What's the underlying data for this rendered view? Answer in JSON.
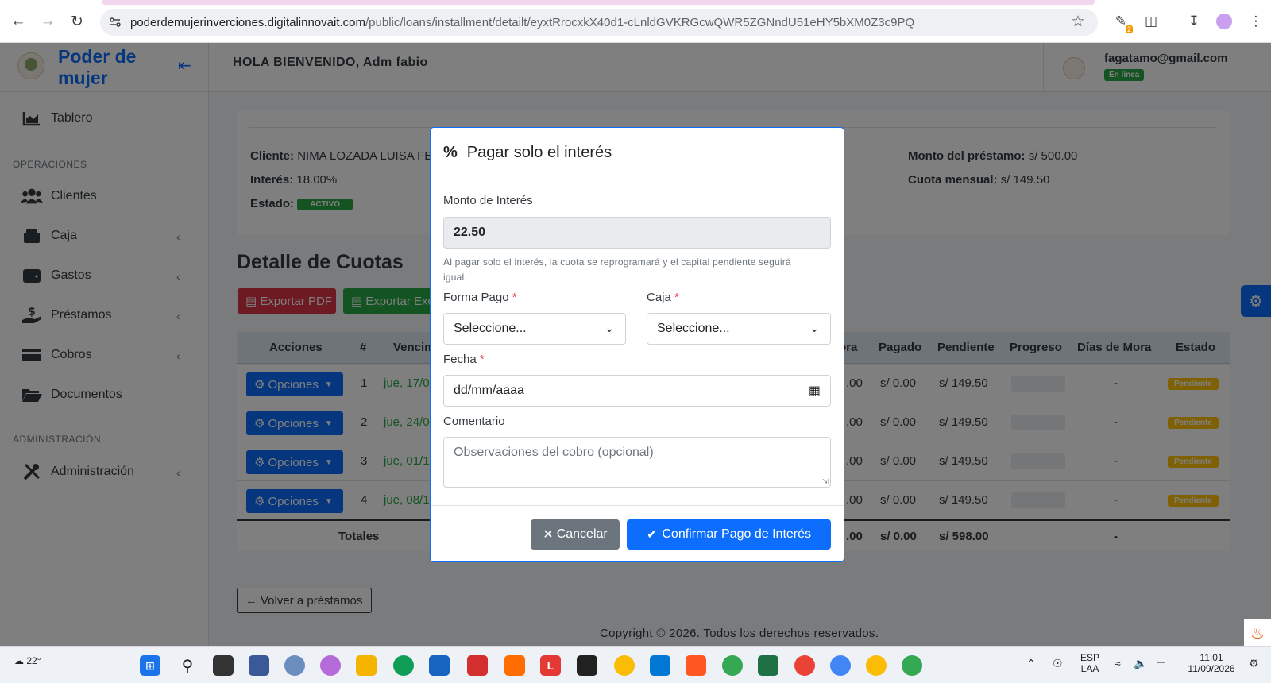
{
  "browser": {
    "url_host": "poderdemujerinverciones.digitalinnovait.com",
    "url_path": "/public/loans/installment/detailt/eyxtRrocxkX40d1-cLnldGVKRGcwQWR5ZGNndU51eHY5bXM0Z3c9PQ",
    "ext_badge": "2"
  },
  "sidebar": {
    "brand": "Poder de mujer",
    "items": [
      {
        "label": "Tablero",
        "icon": "chart-area-icon"
      },
      {
        "label": "Clientes",
        "icon": "users-icon"
      },
      {
        "label": "Caja",
        "icon": "cash-box-icon"
      },
      {
        "label": "Gastos",
        "icon": "wallet-icon"
      },
      {
        "label": "Préstamos",
        "icon": "hand-dollar-icon"
      },
      {
        "label": "Cobros",
        "icon": "credit-card-icon"
      },
      {
        "label": "Documentos",
        "icon": "folder-icon"
      },
      {
        "label": "Administración",
        "icon": "tools-icon"
      }
    ],
    "sections": {
      "operaciones": "OPERACIONES",
      "administracion": "ADMINISTRACIÓN"
    }
  },
  "topbar": {
    "greeting": "HOLA BIENVENIDO, Adm fabio",
    "email": "fagatamo@gmail.com",
    "status": "En línea"
  },
  "loan": {
    "cliente_label": "Cliente:",
    "cliente": "NIMA LOZADA LUISA FE",
    "interes_label": "Interés:",
    "interes": "18.00%",
    "estado_label": "Estado:",
    "estado": "ACTIVO",
    "monto_label": "Monto del préstamo:",
    "monto": "s/ 500.00",
    "cuota_label": "Cuota mensual:",
    "cuota": "s/ 149.50"
  },
  "detail": {
    "title": "Detalle de Cuotas",
    "export_pdf": "Exportar PDF",
    "export_excel": "Exportar Exc",
    "columns": [
      "Acciones",
      "#",
      "Vencim",
      "ora",
      "Pagado",
      "Pendiente",
      "Progreso",
      "Días de Mora",
      "Estado"
    ],
    "rows": [
      {
        "action": "Opciones",
        "num": "1",
        "venc": "jue, 17/0",
        "mora": ".00",
        "pagado": "s/ 0.00",
        "pendiente": "s/ 149.50",
        "dias": "-",
        "estado": "Pendiente"
      },
      {
        "action": "Opciones",
        "num": "2",
        "venc": "jue, 24/0",
        "mora": ".00",
        "pagado": "s/ 0.00",
        "pendiente": "s/ 149.50",
        "dias": "-",
        "estado": "Pendiente"
      },
      {
        "action": "Opciones",
        "num": "3",
        "venc": "jue, 01/1",
        "mora": ".00",
        "pagado": "s/ 0.00",
        "pendiente": "s/ 149.50",
        "dias": "-",
        "estado": "Pendiente"
      },
      {
        "action": "Opciones",
        "num": "4",
        "venc": "jue, 08/1",
        "mora": ".00",
        "pagado": "s/ 0.00",
        "pendiente": "s/ 149.50",
        "dias": "-",
        "estado": "Pendiente"
      }
    ],
    "totals": {
      "label": "Totales",
      "mora": ".00",
      "pagado": "s/ 0.00",
      "pendiente": "s/ 598.00",
      "dias": "-"
    },
    "back": "Volver a préstamos"
  },
  "footer": {
    "copyright": "Copyright © 2026. Todos los derechos reservados."
  },
  "modal": {
    "title": "Pagar solo el interés",
    "monto_label": "Monto de Interés",
    "monto_value": "22.50",
    "help": "Al pagar solo el interés, la cuota se reprogramará y el capital pendiente seguirá igual.",
    "forma_pago_label": "Forma Pago",
    "forma_pago_value": "Seleccione...",
    "caja_label": "Caja",
    "caja_value": "Seleccione...",
    "fecha_label": "Fecha",
    "fecha_value": "dd/mm/aaaa",
    "comentario_label": "Comentario",
    "comentario_placeholder": "Observaciones del cobro (opcional)",
    "required_mark": "*",
    "cancel": "Cancelar",
    "confirm": "Confirmar Pago de Interés"
  },
  "taskbar": {
    "temperature": "22°",
    "lang": "ESP",
    "layout": "LAA",
    "time": "11:01",
    "date": "11/09/2026"
  },
  "colors": {
    "primary": "#0d6efd",
    "danger": "#dc3545",
    "success": "#28a745",
    "warning": "#ffc107",
    "secondary": "#6c757d"
  }
}
